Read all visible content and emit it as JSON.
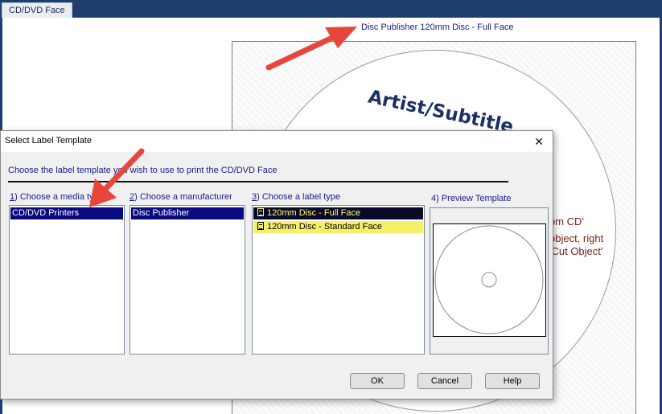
{
  "app": {
    "tab_label": "CD/DVD Face",
    "template_title": "Disc Publisher 120mm Disc - Full Face",
    "artist_text": "Artist/Subtitle",
    "hint_lines": [
      "om CD'",
      "object, right",
      "'Cut Object'"
    ]
  },
  "dialog": {
    "title": "Select Label Template",
    "close_glyph": "✕",
    "instruction": "Choose the label template you wish to use to print the CD/DVD Face",
    "columns": [
      {
        "num": "1",
        "label": ") Choose a media type"
      },
      {
        "num": "2",
        "label": ") Choose a manufacturer"
      },
      {
        "num": "3",
        "label": ") Choose a label type"
      },
      {
        "num": "4",
        "label": ") Preview Template"
      }
    ],
    "media_types": [
      "CD/DVD Printers"
    ],
    "manufacturers": [
      "Disc Publisher"
    ],
    "label_types": [
      "120mm Disc - Full Face",
      "120mm Disc - Standard Face"
    ],
    "buttons": {
      "ok": "OK",
      "cancel": "Cancel",
      "help": "Help"
    }
  },
  "colors": {
    "titlebar_dark": "#1e3f6e",
    "link_blue": "#1a1a8c",
    "selection": "#0a0a80",
    "highlight_yellow": "#f4f06a",
    "arrow_red": "#e8463c",
    "hint_red": "#7a1e12"
  }
}
